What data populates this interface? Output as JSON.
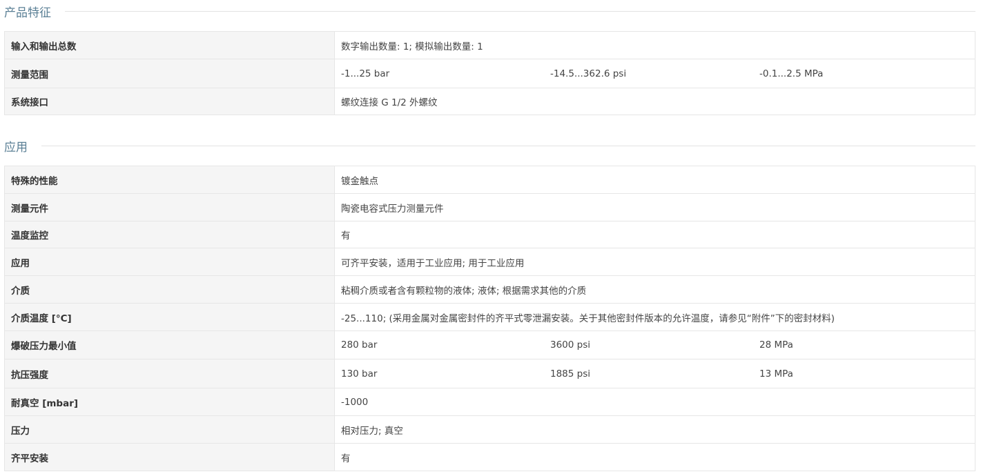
{
  "sections": [
    {
      "title": "产品特征",
      "rows": [
        {
          "label": "输入和输出总数",
          "values": [
            "数字输出数量: 1; 模拟输出数量: 1"
          ]
        },
        {
          "label": "测量范围",
          "values": [
            "-1...25 bar",
            "-14.5...362.6 psi",
            "-0.1...2.5 MPa"
          ]
        },
        {
          "label": "系统接口",
          "values": [
            "螺纹连接 G 1/2 外螺纹"
          ]
        }
      ]
    },
    {
      "title": "应用",
      "rows": [
        {
          "label": "特殊的性能",
          "values": [
            "镀金触点"
          ]
        },
        {
          "label": "测量元件",
          "values": [
            "陶瓷电容式压力测量元件"
          ]
        },
        {
          "label": "温度监控",
          "values": [
            "有"
          ]
        },
        {
          "label": "应用",
          "values": [
            "可齐平安装，适用于工业应用; 用于工业应用"
          ]
        },
        {
          "label": "介质",
          "values": [
            "粘稠介质或者含有颗粒物的液体; 液体; 根据需求其他的介质"
          ]
        },
        {
          "label": "介质温度 [°C]",
          "values": [
            "-25...110; (采用金属对金属密封件的齐平式零泄漏安装。关于其他密封件版本的允许温度，请参见“附件”下的密封材料)"
          ]
        },
        {
          "label": "爆破压力最小值",
          "values": [
            "280 bar",
            "3600 psi",
            "28 MPa"
          ]
        },
        {
          "label": "抗压强度",
          "values": [
            "130 bar",
            "1885 psi",
            "13 MPa"
          ]
        },
        {
          "label": "耐真空 [mbar]",
          "values": [
            "-1000"
          ]
        },
        {
          "label": "压力",
          "values": [
            "相对压力; 真空"
          ]
        },
        {
          "label": "齐平安装",
          "values": [
            "有"
          ]
        }
      ]
    }
  ]
}
